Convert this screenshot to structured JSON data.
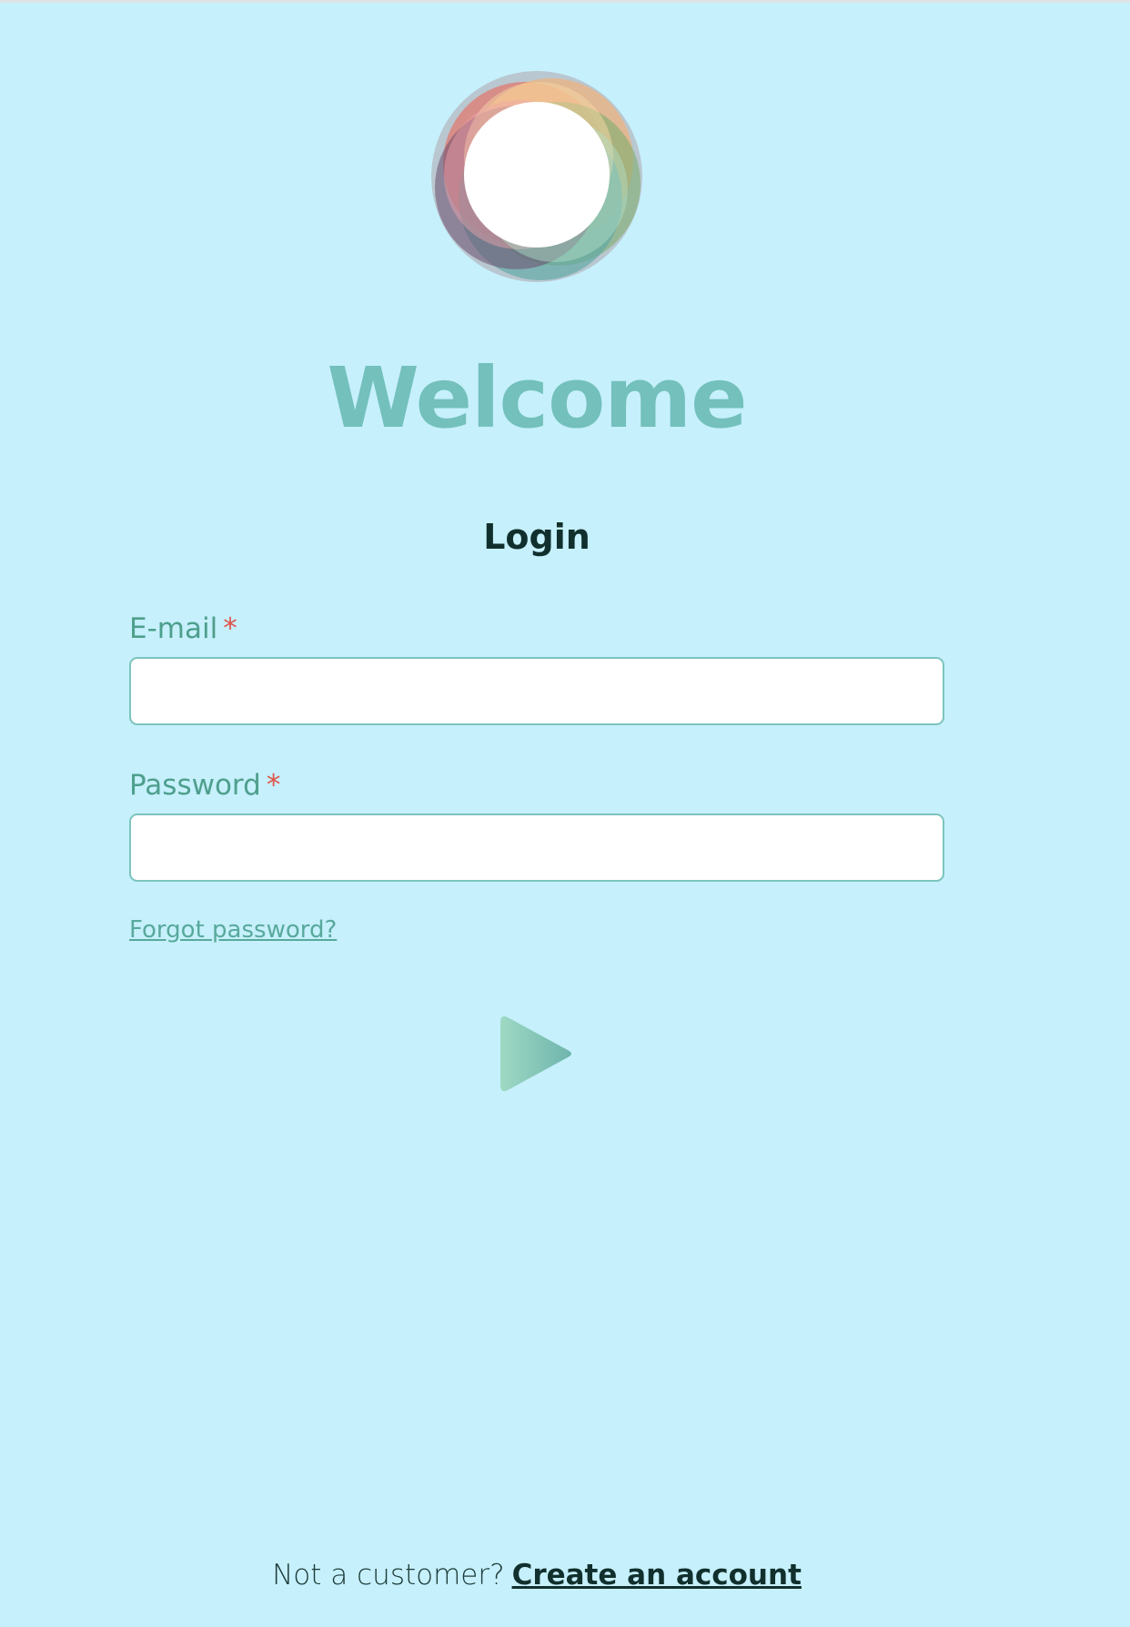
{
  "logo": {
    "icon": "flower-ring-logo-icon"
  },
  "header": {
    "welcome": "Welcome",
    "login_heading": "Login"
  },
  "form": {
    "email_label": "E-mail",
    "password_label": "Password",
    "required_marker": "*",
    "email_value": "",
    "password_value": "",
    "forgot_password": "Forgot password?",
    "submit_icon": "play-arrow-icon"
  },
  "footer": {
    "prompt": "Not a customer?",
    "create_account": "Create an account"
  },
  "colors": {
    "background": "#c6f0fc",
    "accent": "#73c0bc",
    "label": "#4e9f8d",
    "required": "#e0534a",
    "heading": "#11302d"
  }
}
